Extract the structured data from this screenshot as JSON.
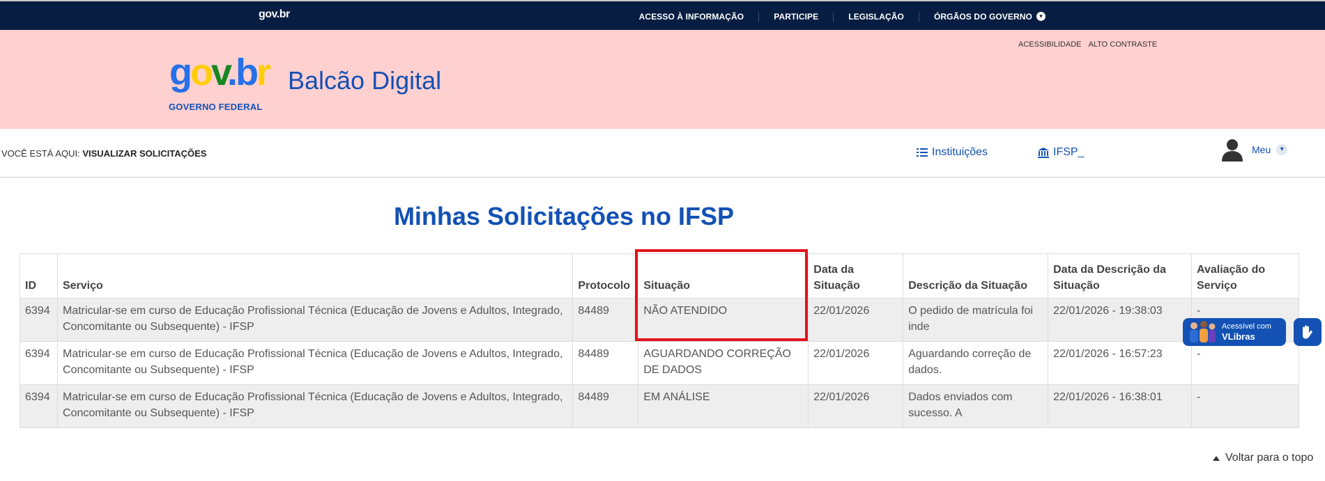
{
  "topbar": {
    "logo": "gov.br",
    "menu": [
      {
        "label": "ACESSO À INFORMAÇÃO"
      },
      {
        "label": "PARTICIPE"
      },
      {
        "label": "LEGISLAÇÃO"
      },
      {
        "label": "ÓRGÃOS DO GOVERNO",
        "icon": "chevron-down-icon"
      }
    ]
  },
  "header": {
    "accessibility": [
      "ACESSIBILIDADE",
      "ALTO CONTRASTE"
    ],
    "logo_subtitle": "GOVERNO FEDERAL",
    "app_name": "Balcão Digital"
  },
  "breadcrumb": {
    "prefix": "VOCÊ ESTÁ AQUI:",
    "current": "VISUALIZAR SOLICITAÇÕES"
  },
  "nav": {
    "instituicoes": "Instituições",
    "ifsp": "IFSP_",
    "user_menu": "Meu"
  },
  "main": {
    "title": "Minhas Solicitações no IFSP",
    "columns": [
      "ID",
      "Serviço",
      "Protocolo",
      "Situação",
      "Data da Situação",
      "Descrição da Situação",
      "Data da Descrição da Situação",
      "Avaliação do Serviço"
    ],
    "rows": [
      [
        "6394",
        "Matricular-se em curso de Educação Profissional Técnica (Educação de Jovens e Adultos, Integrado, Concomitante ou Subsequente) - IFSP",
        "84489",
        "NÃO ATENDIDO",
        "22/01/2026",
        "O pedido de matrícula foi inde",
        "22/01/2026 - 19:38:03",
        "-"
      ],
      [
        "6394",
        "Matricular-se em curso de Educação Profissional Técnica (Educação de Jovens e Adultos, Integrado, Concomitante ou Subsequente) - IFSP",
        "84489",
        "AGUARDANDO CORREÇÃO DE DADOS",
        "22/01/2026",
        "Aguardando correção de dados.",
        "22/01/2026 - 16:57:23",
        "-"
      ],
      [
        "6394",
        "Matricular-se em curso de Educação Profissional Técnica (Educação de Jovens e Adultos, Integrado, Concomitante ou Subsequente) - IFSP",
        "84489",
        "EM ANÁLISE",
        "22/01/2026",
        "Dados enviados com sucesso. A",
        "22/01/2026 - 16:38:01",
        "-"
      ]
    ]
  },
  "vlibras": {
    "line1": "Acessível com",
    "line2": "VLibras"
  },
  "footer": {
    "back_to_top": "Voltar para o topo"
  },
  "colors": {
    "topbar": "#071d41",
    "header_bg": "#ffd0d0",
    "primary": "#1351b4",
    "highlight": "#e3131d"
  }
}
